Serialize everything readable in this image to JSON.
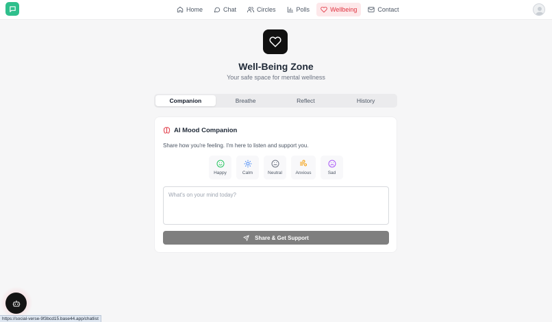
{
  "nav": {
    "items": [
      {
        "label": "Home",
        "icon": "home-icon"
      },
      {
        "label": "Chat",
        "icon": "chat-icon"
      },
      {
        "label": "Circles",
        "icon": "users-icon"
      },
      {
        "label": "Polls",
        "icon": "bar-chart-icon"
      },
      {
        "label": "Wellbeing",
        "icon": "heart-icon",
        "active": true
      },
      {
        "label": "Contact",
        "icon": "mail-icon"
      }
    ]
  },
  "hero": {
    "title": "Well-Being Zone",
    "subtitle": "Your safe space for mental wellness"
  },
  "tabs": [
    {
      "label": "Companion",
      "active": true
    },
    {
      "label": "Breathe"
    },
    {
      "label": "Reflect"
    },
    {
      "label": "History"
    }
  ],
  "companion": {
    "title": "AI Mood Companion",
    "description": "Share how you're feeling. I'm here to listen and support you.",
    "moods": [
      {
        "label": "Happy",
        "icon": "smile-icon",
        "color": "#22c55e"
      },
      {
        "label": "Calm",
        "icon": "sun-icon",
        "color": "#3b82f6"
      },
      {
        "label": "Neutral",
        "icon": "meh-icon",
        "color": "#6b7280"
      },
      {
        "label": "Anxious",
        "icon": "wind-icon",
        "color": "#f59e0b"
      },
      {
        "label": "Sad",
        "icon": "frown-icon",
        "color": "#a855f7"
      }
    ],
    "input_placeholder": "What's on your mind today?",
    "input_value": "",
    "submit_label": "Share & Get Support"
  },
  "colors": {
    "accent": "#e0323f",
    "brand": "#2fbf8c",
    "submit_bg": "#7f7f7f"
  },
  "status_url": "https://social-verse-9f3bcd15.base44.app/chatlist"
}
